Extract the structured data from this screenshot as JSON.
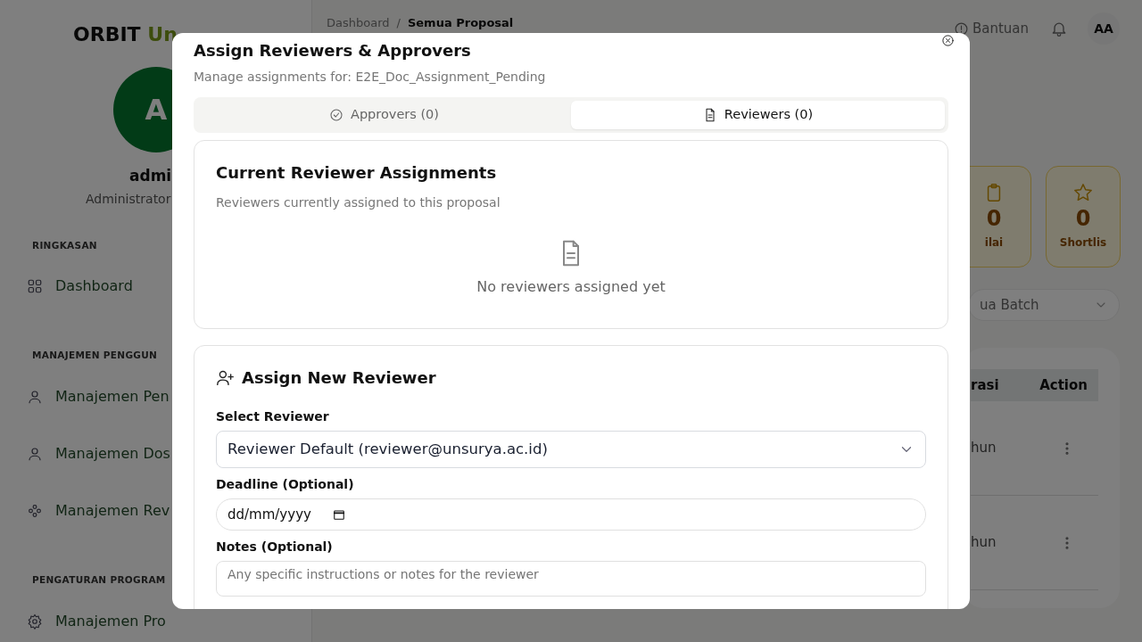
{
  "sidebar": {
    "logo": {
      "text": "ORBIT",
      "accent": "Un"
    },
    "avatar_letter": "A",
    "user_name": "admi",
    "user_role": "Administrator",
    "sections": [
      {
        "title": "RINGKASAN",
        "items": [
          {
            "label": "Dashboard"
          }
        ]
      },
      {
        "title": "MANAJEMEN PENGGUN",
        "items": [
          {
            "label": "Manajemen Pen"
          },
          {
            "label": "Manajemen Dos"
          },
          {
            "label": "Manajemen Rev"
          }
        ]
      },
      {
        "title": "PENGATURAN PROGRAM",
        "items": [
          {
            "label": "Manajemen Pro"
          }
        ]
      }
    ]
  },
  "header": {
    "breadcrumb": [
      "Dashboard",
      "/",
      "Semua Proposal"
    ],
    "help": "Bantuan",
    "avatar": "AA"
  },
  "stat_cards": [
    {
      "value": "0",
      "label": "ilai"
    },
    {
      "value": "0",
      "label": "Shortlis"
    }
  ],
  "batch_filter": {
    "value": "ua Batch"
  },
  "table": {
    "columns": [
      "rasi",
      "Action"
    ],
    "rows": [
      {
        "column_1": "hun"
      },
      {
        "column_1": "hun"
      }
    ]
  },
  "dialog": {
    "title": "Assign Reviewers & Approvers",
    "subtitle": "Manage assignments for: E2E_Doc_Assignment_Pending",
    "tabs": [
      {
        "label": "Approvers (0)",
        "selected": false
      },
      {
        "label": "Reviewers (0)",
        "selected": true
      }
    ],
    "current": {
      "title": "Current Reviewer Assignments",
      "subtitle": "Reviewers currently assigned to this proposal",
      "empty": "No reviewers assigned yet"
    },
    "assign": {
      "title": "Assign New Reviewer",
      "reviewer_label": "Select Reviewer",
      "reviewer_value": "Reviewer Default (reviewer@unsurya.ac.id)",
      "deadline_label": "Deadline (Optional)",
      "deadline_value": "dd/mm/yyyy",
      "notes_label": "Notes (Optional)",
      "notes_placeholder": "Any specific instructions or notes for the reviewer"
    }
  }
}
